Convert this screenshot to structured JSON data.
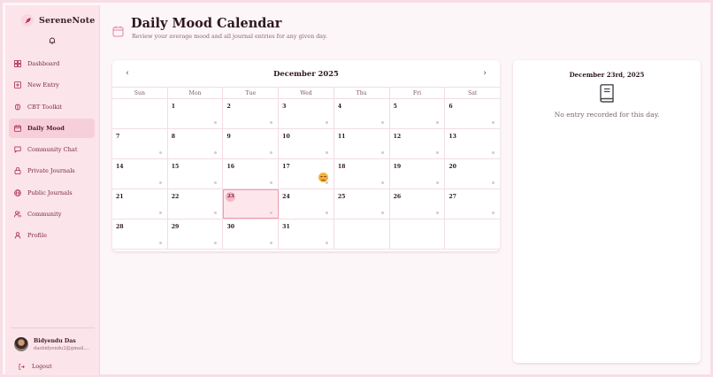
{
  "app": {
    "name": "SereneNote"
  },
  "sidebar": {
    "items": [
      {
        "label": "Dashboard",
        "icon": "dashboard-icon",
        "active": false
      },
      {
        "label": "New Entry",
        "icon": "plus-square-icon",
        "active": false
      },
      {
        "label": "CBT Toolkit",
        "icon": "brain-icon",
        "active": false
      },
      {
        "label": "Daily Mood",
        "icon": "calendar-icon",
        "active": true
      },
      {
        "label": "Community Chat",
        "icon": "chat-icon",
        "active": false
      },
      {
        "label": "Private Journals",
        "icon": "lock-icon",
        "active": false
      },
      {
        "label": "Public Journals",
        "icon": "globe-icon",
        "active": false
      },
      {
        "label": "Community",
        "icon": "users-icon",
        "active": false
      },
      {
        "label": "Profile",
        "icon": "user-icon",
        "active": false
      }
    ],
    "user": {
      "name": "Bidyendu Das",
      "email": "dasbidyendu2@gmail...."
    },
    "logout_label": "Logout"
  },
  "header": {
    "title": "Daily Mood Calendar",
    "subtitle": "Review your average mood and all journal entries for any given day."
  },
  "calendar": {
    "month_label": "December 2025",
    "prev_label": "‹",
    "next_label": "›",
    "weekdays": [
      "Sun",
      "Mon",
      "Tue",
      "Wed",
      "Thu",
      "Fri",
      "Sat"
    ],
    "weeks": [
      [
        "",
        "1",
        "2",
        "3",
        "4",
        "5",
        "6"
      ],
      [
        "7",
        "8",
        "9",
        "10",
        "11",
        "12",
        "13"
      ],
      [
        "14",
        "15",
        "16",
        "17",
        "18",
        "19",
        "20"
      ],
      [
        "21",
        "22",
        "23",
        "24",
        "25",
        "26",
        "27"
      ],
      [
        "28",
        "29",
        "30",
        "31",
        "",
        "",
        ""
      ]
    ],
    "today": "23",
    "mood_days": {
      "17": "happy"
    }
  },
  "detail": {
    "date_label": "December 23rd, 2025",
    "empty_text": "No entry recorded for this day."
  },
  "colors": {
    "accent": "#f4b7c7",
    "active_nav": "#f7cfda",
    "mood": "#f6b431"
  }
}
